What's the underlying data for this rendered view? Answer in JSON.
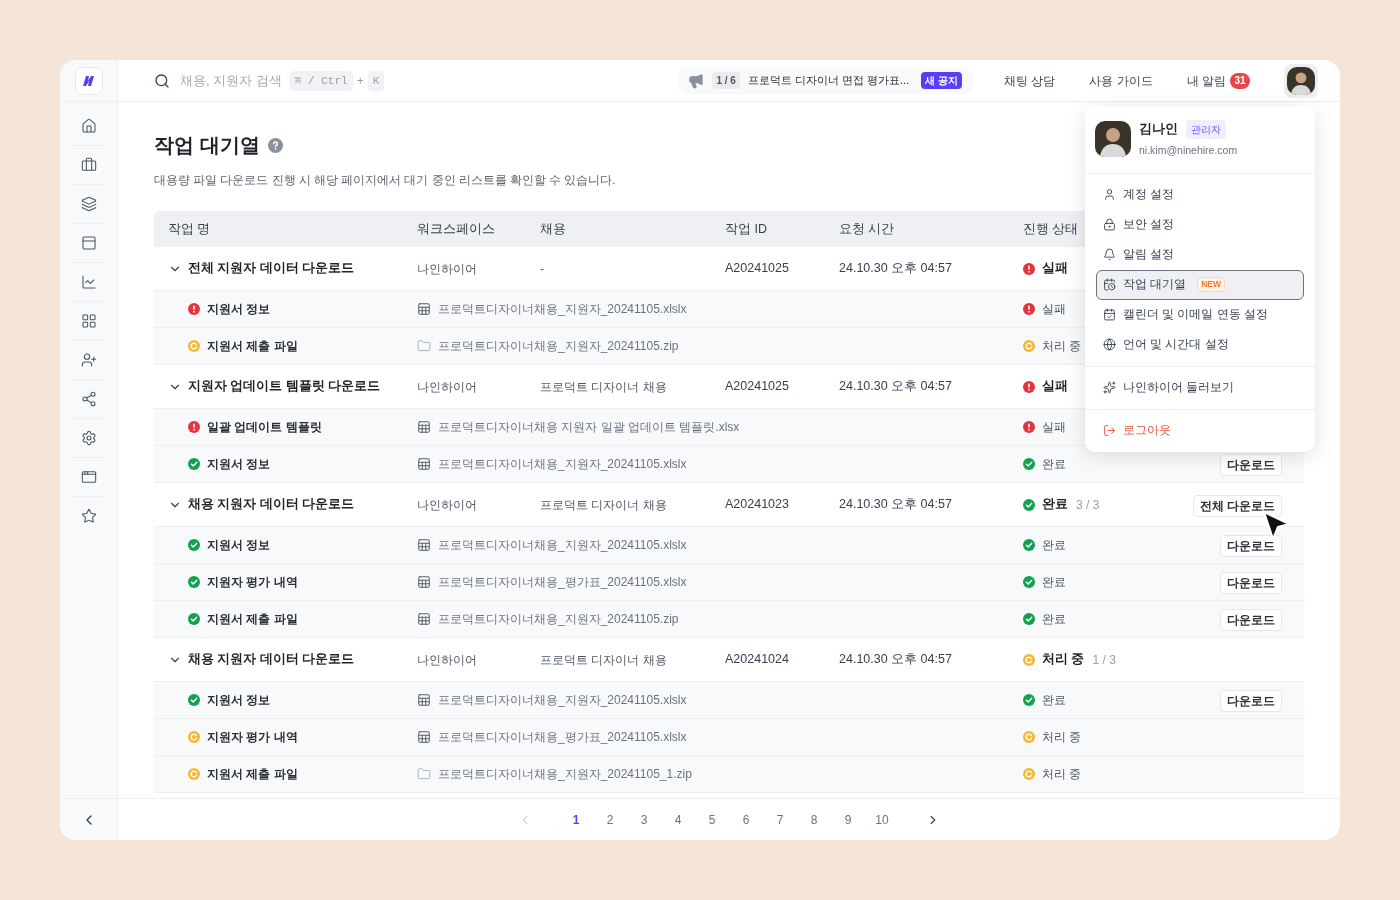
{
  "search": {
    "placeholder": "채용, 지원자 검색",
    "shortcut_keys": [
      "⌘ / Ctrl",
      "K"
    ],
    "shortcut_joiner": "+"
  },
  "notice": {
    "counter": "1 / 6",
    "text": "프로덕트 디자이너 면접 평가표...",
    "badge": "새 공지"
  },
  "nav_links": [
    {
      "label": "채팅 상담"
    },
    {
      "label": "사용 가이드"
    },
    {
      "label": "내 알림",
      "badge": "31"
    }
  ],
  "sidebar": {
    "items": [
      {
        "selected": false
      },
      {
        "selected": false
      },
      {
        "selected": false
      },
      {
        "selected": false
      },
      {
        "selected": false
      },
      {
        "selected": false
      },
      {
        "selected": false
      },
      {
        "selected": false
      },
      {
        "selected": false
      },
      {
        "selected": false
      },
      {
        "selected": false
      }
    ]
  },
  "page": {
    "title": "작업 대기열",
    "description": "대용량 파일 다운로드 진행 시 해당 페이지에서 대기 중인 리스트를 확인할 수 있습니다."
  },
  "table": {
    "columns": [
      "작업 명",
      "워크스페이스",
      "채용",
      "작업 ID",
      "요청 시간",
      "진행 상태"
    ],
    "groups": [
      {
        "name": "전체 지원자 데이터 다운로드",
        "expanded": true,
        "workspace": "나인하이어",
        "posting": "-",
        "job_id": "A20241025",
        "requested_at": "24.10.30 오후 04:57",
        "status": {
          "kind": "failed",
          "label": "실패"
        },
        "items": [
          {
            "name": "지원서 정보",
            "file": {
              "kind": "sheet",
              "name": "프로덕트디자이너채용_지원자_20241105.xlslx"
            },
            "status": {
              "kind": "failed",
              "label": "실패"
            }
          },
          {
            "name": "지원서 제출 파일",
            "file": {
              "kind": "folder",
              "name": "프로덕트디자이너채용_지원자_20241105.zip"
            },
            "status": {
              "kind": "processing",
              "label": "처리 중"
            }
          }
        ]
      },
      {
        "name": "지원자 업데이트 템플릿 다운로드",
        "expanded": true,
        "workspace": "나인하이어",
        "posting": "프로덕트 디자이너 채용",
        "job_id": "A20241025",
        "requested_at": "24.10.30 오후 04:57",
        "status": {
          "kind": "failed",
          "label": "실패"
        },
        "items": [
          {
            "name": "일괄 업데이트 템플릿",
            "file": {
              "kind": "sheet",
              "name": "프로덕트디자이너채용 지원자 일괄 업데이트 템플릿.xlsx"
            },
            "status": {
              "kind": "failed",
              "label": "실패"
            }
          },
          {
            "name": "지원서 정보",
            "file": {
              "kind": "sheet",
              "name": "프로덕트디자이너채용_지원자_20241105.xlslx"
            },
            "status": {
              "kind": "done",
              "label": "완료"
            },
            "action": "다운로드"
          }
        ]
      },
      {
        "name": "채용 지원자 데이터 다운로드",
        "expanded": true,
        "workspace": "나인하이어",
        "posting": "프로덕트 디자이너 채용",
        "job_id": "A20241023",
        "requested_at": "24.10.30 오후 04:57",
        "status": {
          "kind": "done",
          "label": "완료",
          "count": "3 / 3"
        },
        "action": "전체 다운로드",
        "items": [
          {
            "name": "지원서 정보",
            "file": {
              "kind": "sheet",
              "name": "프로덕트디자이너채용_지원자_20241105.xlslx"
            },
            "status": {
              "kind": "done",
              "label": "완료"
            },
            "action": "다운로드"
          },
          {
            "name": "지원자 평가 내역",
            "file": {
              "kind": "sheet",
              "name": "프로덕트디자이너채용_평가표_20241105.xlslx"
            },
            "status": {
              "kind": "done",
              "label": "완료"
            },
            "action": "다운로드"
          },
          {
            "name": "지원서 제출 파일",
            "file": {
              "kind": "sheet",
              "name": "프로덕트디자이너채용_지원자_20241105.zip"
            },
            "status": {
              "kind": "done",
              "label": "완료"
            },
            "action": "다운로드"
          }
        ]
      },
      {
        "name": "채용 지원자 데이터 다운로드",
        "expanded": true,
        "workspace": "나인하이어",
        "posting": "프로덕트 디자이너 채용",
        "job_id": "A20241024",
        "requested_at": "24.10.30 오후 04:57",
        "status": {
          "kind": "processing",
          "label": "처리 중",
          "count": "1 / 3"
        },
        "items": [
          {
            "name": "지원서 정보",
            "file": {
              "kind": "sheet",
              "name": "프로덕트디자이너채용_지원자_20241105.xlslx"
            },
            "status": {
              "kind": "done",
              "label": "완료"
            },
            "action": "다운로드"
          },
          {
            "name": "지원자 평가 내역",
            "file": {
              "kind": "sheet",
              "name": "프로덕트디자이너채용_평가표_20241105.xlslx"
            },
            "status": {
              "kind": "processing",
              "label": "처리 중"
            }
          },
          {
            "name": "지원서 제출 파일",
            "file": {
              "kind": "folder",
              "name": "프로덕트디자이너채용_지원자_20241105_1.zip"
            },
            "status": {
              "kind": "processing",
              "label": "처리 중"
            }
          }
        ]
      }
    ]
  },
  "pagination": {
    "pages": [
      {
        "label": "1",
        "selected": true
      },
      {
        "label": "2",
        "selected": false
      },
      {
        "label": "3",
        "selected": false
      },
      {
        "label": "4",
        "selected": false
      },
      {
        "label": "5",
        "selected": false
      },
      {
        "label": "6",
        "selected": false
      },
      {
        "label": "7",
        "selected": false
      },
      {
        "label": "8",
        "selected": false
      },
      {
        "label": "9",
        "selected": false
      },
      {
        "label": "10",
        "selected": false
      }
    ],
    "prev_disabled": true
  },
  "profile_menu": {
    "name": "김나인",
    "role": "관리자",
    "email": "ni.kim@ninehire.com",
    "sections": [
      [
        {
          "label": "계정 설정",
          "selected": false
        },
        {
          "label": "보안 설정",
          "selected": false
        },
        {
          "label": "알림 설정",
          "selected": false
        },
        {
          "label": "작업 대기열",
          "badge": "NEW",
          "selected": true
        },
        {
          "label": "캘린더 및 이메일 연동 설정",
          "selected": false
        },
        {
          "label": "언어 및 시간대 설정",
          "selected": false
        }
      ],
      [
        {
          "label": "나인하이어 둘러보기",
          "selected": false
        }
      ],
      [
        {
          "label": "로그아웃",
          "kind": "danger",
          "selected": false
        }
      ]
    ]
  }
}
